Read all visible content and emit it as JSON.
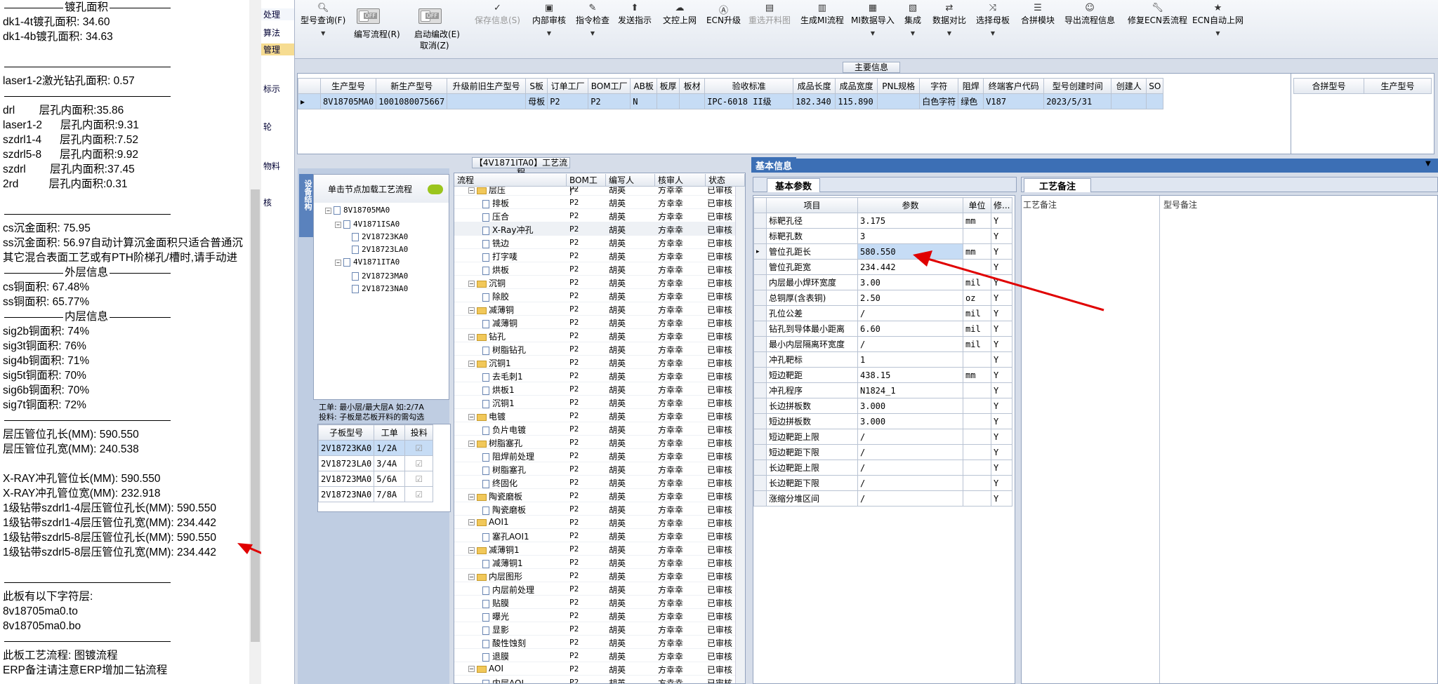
{
  "left_notes": {
    "sep1": "镀孔面积",
    "dk1_4t": "dk1-4t镀孔面积: 34.60",
    "dk1_4b": "dk1-4b镀孔面积: 34.63",
    "laser": "laser1-2激光钻孔面积: 0.57",
    "drl": "drl        层孔内面积:35.86",
    "laser12": "laser1-2      层孔内面积:9.31",
    "szdrl14": "szdrl1-4      层孔内面积:7.52",
    "szdrl58": "szdrl5-8      层孔内面积:9.92",
    "szdrl": "szdrl        层孔内面积:37.45",
    "rd2": "2rd          层孔内面积:0.31",
    "cs_sink": "cs沉金面积: 75.95",
    "ss_sink": "ss沉金面积: 56.97自动计算沉金面积只适合普通沉",
    "ss_sink2": "其它混合表面工艺或有PTH阶梯孔/槽时,请手动进",
    "sep_outer": "外层信息",
    "cs_cu": "cs铜面积: 67.48%",
    "ss_cu": "ss铜面积: 65.77%",
    "sep_inner": "内层信息",
    "sig2b": "sig2b铜面积: 74%",
    "sig3t": "sig3t铜面积: 76%",
    "sig4b": "sig4b铜面积: 71%",
    "sig5t": "sig5t铜面积: 70%",
    "sig6b": "sig6b铜面积: 70%",
    "sig7t": "sig7t铜面积: 72%",
    "layer_len": "层压管位孔长(MM): 590.550",
    "layer_wid": "层压管位孔宽(MM): 240.538",
    "xray_len": "X-RAY冲孔管位长(MM): 590.550",
    "xray_wid": "X-RAY冲孔管位宽(MM): 232.918",
    "d1": "1级钻带szdrl1-4层压管位孔长(MM): 590.550",
    "d2": "1级钻带szdrl1-4层压管位孔宽(MM): 234.442",
    "d3": "1级钻带szdrl5-8层压管位孔长(MM): 590.550",
    "d4": "1级钻带szdrl5-8层压管位孔宽(MM): 234.442",
    "char_layers": "此板有以下字符层:",
    "to": "8v18705ma0.to",
    "bo": "8v18705ma0.bo",
    "flow": "此板工艺流程: 图镀流程",
    "erp": "ERP备注请注意ERP增加二钻流程"
  },
  "side_menu": [
    "处理",
    "算法",
    "管理",
    "标示",
    "轮",
    "物料",
    "核"
  ],
  "toolbar": {
    "model_query": "型号查询(F)",
    "edit_flow": "编写流程(R)",
    "start_edit": "启动编改(E)",
    "cancel": "取消(Z)",
    "save": "保存信息(S)",
    "internal_review": "内部审核",
    "instr_check": "指令检查",
    "send_instr": "发送指示",
    "doc_upload": "文控上网",
    "ecn_upgrade": "ECN升级",
    "regen_panel": "重选开料图",
    "gen_mi": "生成MI流程",
    "mi_import": "MI数据导入",
    "integrate": "集成",
    "compare": "数据对比",
    "select_master": "选择母板",
    "merge": "合拼模块",
    "export_flow": "导出流程信息",
    "fix_ecn": "修复ECN丢流程",
    "ecn_auto": "ECN自动上网",
    "off": "OFF"
  },
  "main_info": {
    "title": "主要信息",
    "headers": [
      "生产型号",
      "新生产型号",
      "升级前旧生产型号",
      "S板",
      "订单工厂",
      "BOM工厂",
      "AB板",
      "板厚",
      "板材",
      "验收标准",
      "成品长度",
      "成品宽度",
      "PNL规格",
      "字符",
      "阻焊",
      "终端客户代码",
      "型号创建时间",
      "创建人",
      "SO"
    ],
    "row": [
      "8V18705MA0",
      "1001080075667",
      "",
      "母板",
      "P2",
      "P2",
      "N",
      "",
      "",
      "IPC-6018 II级",
      "182.340",
      "115.890",
      "",
      "白色字符",
      "绿色",
      "V187",
      "2023/5/31",
      "",
      ""
    ],
    "right_headers": [
      "合拼型号",
      "生产型号"
    ]
  },
  "flow_title": "【4V1871ITA0】工艺流程",
  "tree": {
    "tab": "设备结构",
    "hint": "单击节点加载工艺流程",
    "nodes": [
      "8V18705MA0",
      "4V1871ISA0",
      "2V18723KA0",
      "2V18723LA0",
      "4V1871ITA0",
      "2V18723MA0",
      "2V18723NA0"
    ],
    "note1": "工单: 最小层/最大层A 如:2/7A",
    "note2": "投料: 子板是芯板开料的需勾选",
    "sub_headers": [
      "子板型号",
      "工单",
      "投料"
    ],
    "sub_rows": [
      [
        "2V18723KA0",
        "1/2A"
      ],
      [
        "2V18723LA0",
        "3/4A"
      ],
      [
        "2V18723MA0",
        "5/6A"
      ],
      [
        "2V18723NA0",
        "7/8A"
      ]
    ]
  },
  "process": {
    "headers": [
      "流程",
      "BOM工厂",
      "编写人",
      "核审人",
      "状态"
    ],
    "rows": [
      [
        "f",
        "层压",
        "P2",
        "胡英",
        "方幸幸",
        "已审核"
      ],
      [
        "d",
        "排板",
        "P2",
        "胡英",
        "方幸幸",
        "已审核"
      ],
      [
        "d",
        "压合",
        "P2",
        "胡英",
        "方幸幸",
        "已审核"
      ],
      [
        "d",
        "X-Ray冲孔",
        "P2",
        "胡英",
        "方幸幸",
        "已审核"
      ],
      [
        "d",
        "铣边",
        "P2",
        "胡英",
        "方幸幸",
        "已审核"
      ],
      [
        "d",
        "打字唛",
        "P2",
        "胡英",
        "方幸幸",
        "已审核"
      ],
      [
        "d",
        "烘板",
        "P2",
        "胡英",
        "方幸幸",
        "已审核"
      ],
      [
        "f",
        "沉铜",
        "P2",
        "胡英",
        "方幸幸",
        "已审核"
      ],
      [
        "d",
        "除胶",
        "P2",
        "胡英",
        "方幸幸",
        "已审核"
      ],
      [
        "f",
        "减薄铜",
        "P2",
        "胡英",
        "方幸幸",
        "已审核"
      ],
      [
        "d",
        "减薄铜",
        "P2",
        "胡英",
        "方幸幸",
        "已审核"
      ],
      [
        "f",
        "钻孔",
        "P2",
        "胡英",
        "方幸幸",
        "已审核"
      ],
      [
        "d",
        "树脂钻孔",
        "P2",
        "胡英",
        "方幸幸",
        "已审核"
      ],
      [
        "f",
        "沉铜1",
        "P2",
        "胡英",
        "方幸幸",
        "已审核"
      ],
      [
        "d",
        "去毛刺1",
        "P2",
        "胡英",
        "方幸幸",
        "已审核"
      ],
      [
        "d",
        "烘板1",
        "P2",
        "胡英",
        "方幸幸",
        "已审核"
      ],
      [
        "d",
        "沉铜1",
        "P2",
        "胡英",
        "方幸幸",
        "已审核"
      ],
      [
        "f",
        "电镀",
        "P2",
        "胡英",
        "方幸幸",
        "已审核"
      ],
      [
        "d",
        "负片电镀",
        "P2",
        "胡英",
        "方幸幸",
        "已审核"
      ],
      [
        "f",
        "树脂塞孔",
        "P2",
        "胡英",
        "方幸幸",
        "已审核"
      ],
      [
        "d",
        "阻焊前处理",
        "P2",
        "胡英",
        "方幸幸",
        "已审核"
      ],
      [
        "d",
        "树脂塞孔",
        "P2",
        "胡英",
        "方幸幸",
        "已审核"
      ],
      [
        "d",
        "终固化",
        "P2",
        "胡英",
        "方幸幸",
        "已审核"
      ],
      [
        "f",
        "陶瓷磨板",
        "P2",
        "胡英",
        "方幸幸",
        "已审核"
      ],
      [
        "d",
        "陶瓷磨板",
        "P2",
        "胡英",
        "方幸幸",
        "已审核"
      ],
      [
        "f",
        "AOI1",
        "P2",
        "胡英",
        "方幸幸",
        "已审核"
      ],
      [
        "d",
        "塞孔AOI1",
        "P2",
        "胡英",
        "方幸幸",
        "已审核"
      ],
      [
        "f",
        "减薄铜1",
        "P2",
        "胡英",
        "方幸幸",
        "已审核"
      ],
      [
        "d",
        "减薄铜1",
        "P2",
        "胡英",
        "方幸幸",
        "已审核"
      ],
      [
        "f",
        "内层图形",
        "P2",
        "胡英",
        "方幸幸",
        "已审核"
      ],
      [
        "d",
        "内层前处理",
        "P2",
        "胡英",
        "方幸幸",
        "已审核"
      ],
      [
        "d",
        "贴膜",
        "P2",
        "胡英",
        "方幸幸",
        "已审核"
      ],
      [
        "d",
        "曝光",
        "P2",
        "胡英",
        "方幸幸",
        "已审核"
      ],
      [
        "d",
        "显影",
        "P2",
        "胡英",
        "方幸幸",
        "已审核"
      ],
      [
        "d",
        "酸性蚀刻",
        "P2",
        "胡英",
        "方幸幸",
        "已审核"
      ],
      [
        "d",
        "退膜",
        "P2",
        "胡英",
        "方幸幸",
        "已审核"
      ],
      [
        "f",
        "AOI",
        "P2",
        "胡英",
        "方幸幸",
        "已审核"
      ],
      [
        "d",
        "内层AOI",
        "P2",
        "胡英",
        "方幸幸",
        "已审核"
      ]
    ]
  },
  "basic": {
    "tab": "基本信息",
    "subtab": "基本参数",
    "headers": [
      "项目",
      "参数",
      "单位",
      "修..."
    ],
    "rows": [
      [
        "标靶孔径",
        "3.175",
        "mm",
        "Y"
      ],
      [
        "标靶孔数",
        "3",
        "",
        "Y"
      ],
      [
        "管位孔距长",
        "580.550",
        "mm",
        "Y"
      ],
      [
        "管位孔距宽",
        "234.442",
        "",
        "Y"
      ],
      [
        "内层最小焊环宽度",
        "3.00",
        "mil",
        "Y"
      ],
      [
        "总铜厚(含表铜)",
        "2.50",
        "oz",
        "Y"
      ],
      [
        "孔位公差",
        "/",
        "mil",
        "Y"
      ],
      [
        "钻孔到导体最小距离",
        "6.60",
        "mil",
        "Y"
      ],
      [
        "最小内层隔离环宽度",
        "/",
        "mil",
        "Y"
      ],
      [
        "冲孔靶标",
        "1",
        "",
        "Y"
      ],
      [
        "短边靶距",
        "438.15",
        "mm",
        "Y"
      ],
      [
        "冲孔程序",
        "N1824_1",
        "",
        "Y"
      ],
      [
        "长边拼板数",
        "3.000",
        "",
        "Y"
      ],
      [
        "短边拼板数",
        "3.000",
        "",
        "Y"
      ],
      [
        "短边靶距上限",
        "/",
        "",
        "Y"
      ],
      [
        "短边靶距下限",
        "/",
        "",
        "Y"
      ],
      [
        "长边靶距上限",
        "/",
        "",
        "Y"
      ],
      [
        "长边靶距下限",
        "/",
        "",
        "Y"
      ],
      [
        "涨缩分堆区间",
        "/",
        "",
        "Y"
      ]
    ]
  },
  "remarks": {
    "tab": "工艺备注",
    "col1": "工艺备注",
    "col2": "型号备注"
  },
  "colors": {
    "accent": "#3c6fb5",
    "arrow": "#e00000",
    "selected": "#c6dcf5"
  }
}
